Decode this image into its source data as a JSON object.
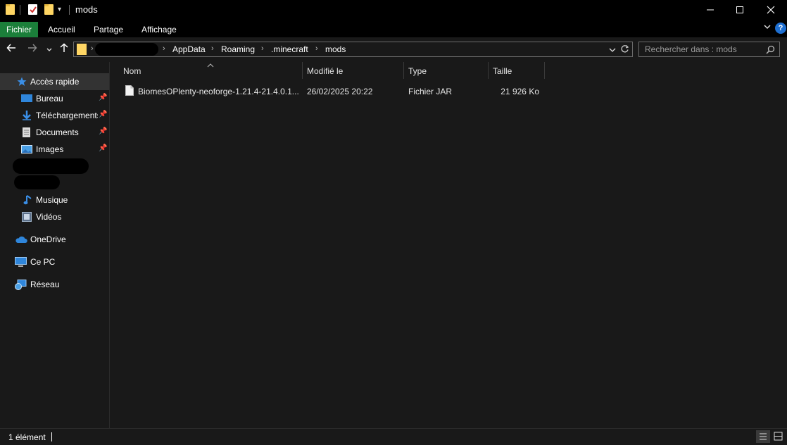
{
  "window": {
    "title": "mods",
    "controls": [
      "minimize-icon",
      "maximize-icon",
      "close-icon"
    ]
  },
  "ribbon": {
    "tabs": [
      "Fichier",
      "Accueil",
      "Partage",
      "Affichage"
    ],
    "help_label": "?"
  },
  "address_bar": {
    "crumbs": [
      "AppData",
      "Roaming",
      ".minecraft",
      "mods"
    ]
  },
  "search": {
    "placeholder": "Rechercher dans : mods"
  },
  "sidebar": {
    "quick_access": "Accès rapide",
    "items": [
      {
        "label": "Bureau",
        "icon": "desktop-icon",
        "pinned": true
      },
      {
        "label": "Téléchargements",
        "icon": "download-icon",
        "pinned": true
      },
      {
        "label": "Documents",
        "icon": "documents-icon",
        "pinned": true
      },
      {
        "label": "Images",
        "icon": "images-icon",
        "pinned": true
      },
      {
        "label": "Musique",
        "icon": "music-icon",
        "pinned": false
      },
      {
        "label": "Vidéos",
        "icon": "videos-icon",
        "pinned": false
      }
    ],
    "roots": [
      {
        "label": "OneDrive",
        "icon": "cloud-icon"
      },
      {
        "label": "Ce PC",
        "icon": "computer-icon"
      },
      {
        "label": "Réseau",
        "icon": "network-icon"
      }
    ]
  },
  "file_list": {
    "columns": [
      "Nom",
      "Modifié le",
      "Type",
      "Taille"
    ],
    "rows": [
      {
        "name": "BiomesOPlenty-neoforge-1.21.4-21.4.0.1...",
        "modified": "26/02/2025 20:22",
        "type": "Fichier JAR",
        "size": "21 926 Ko"
      }
    ]
  },
  "status": {
    "count_text": "1 élément"
  },
  "colors": {
    "background": "#191919",
    "titlebar": "#000000",
    "file_tab": "#1b7f3a",
    "selected": "#333333",
    "folder": "#ffd664"
  }
}
